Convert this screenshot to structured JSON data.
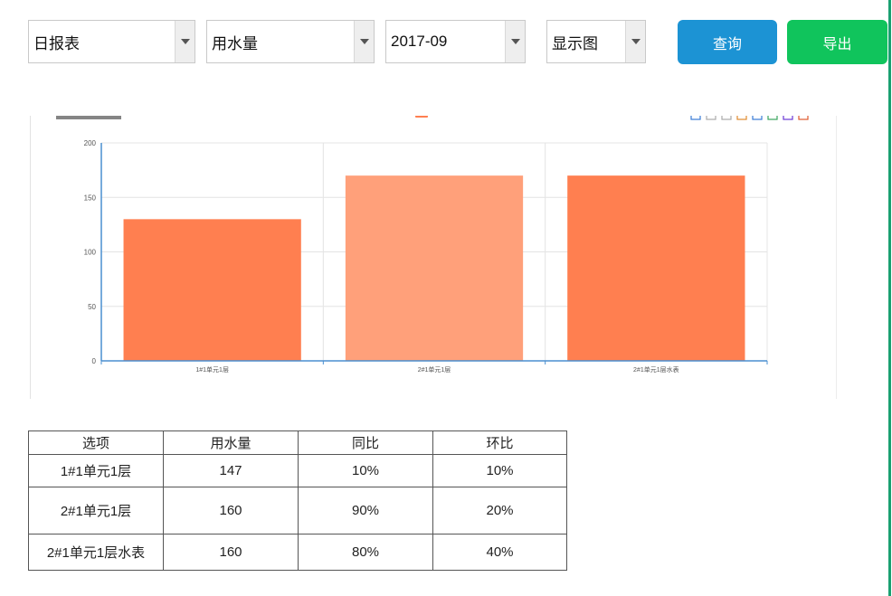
{
  "toolbar": {
    "report_type": {
      "value": "日报表"
    },
    "metric": {
      "value": "用水量"
    },
    "period": {
      "value": "2017-09"
    },
    "view_mode": {
      "value": "显示图"
    },
    "query_label": "查询",
    "export_label": "导出"
  },
  "chart_toolbox": {
    "icons": [
      "zoom-icon",
      "zoom-reset-icon",
      "data-view-icon",
      "line-chart-icon",
      "bar-chart-icon",
      "stack-icon",
      "restore-icon",
      "save-image-icon"
    ]
  },
  "chart_data": {
    "type": "bar",
    "title": "",
    "legend": "",
    "legend_placement": "top-center",
    "categories": [
      "1#1单元1层",
      "2#1单元1层",
      "2#1单元1层水表"
    ],
    "series": [
      {
        "values": [
          130,
          170,
          170
        ]
      }
    ],
    "bar_colors": [
      "#ff7f50",
      "#ffa07a",
      "#ff7f50"
    ],
    "ylim": [
      0,
      200
    ],
    "yticks": [
      0,
      50,
      100,
      150,
      200
    ],
    "grid": true,
    "axis_color": "#4a8fd0"
  },
  "table": {
    "headers": [
      "选项",
      "用水量",
      "同比",
      "环比"
    ],
    "rows": [
      [
        "1#1单元1层",
        "147",
        "10%",
        "10%"
      ],
      [
        "2#1单元1层",
        "160",
        "90%",
        "20%"
      ],
      [
        "2#1单元1层水表",
        "160",
        "80%",
        "40%"
      ]
    ]
  },
  "colors": {
    "query_button": "#1c93d4",
    "export_button": "#10c45c",
    "accent_rule": "#1aa071"
  }
}
